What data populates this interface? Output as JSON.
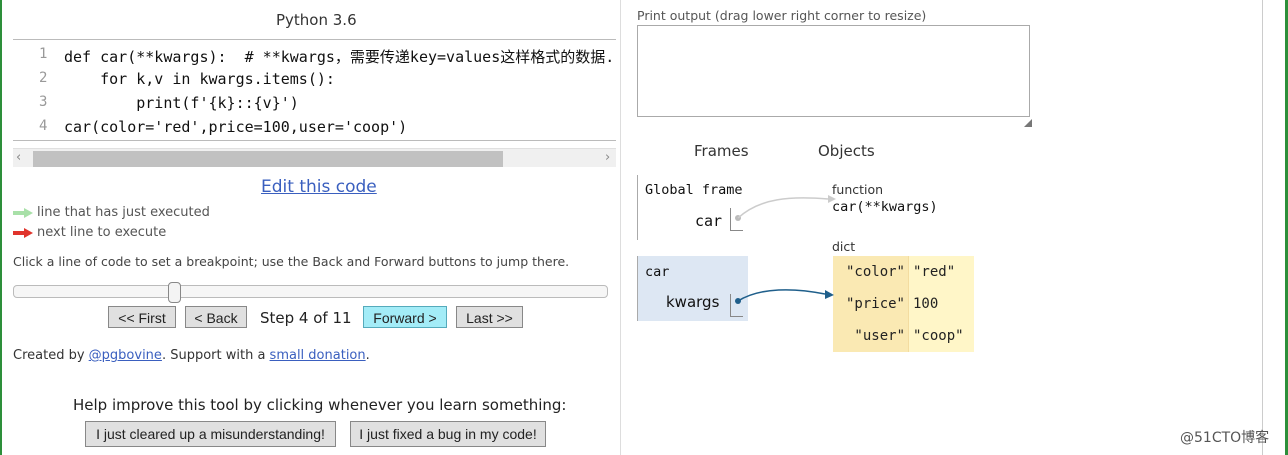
{
  "left_panel": {
    "language": "Python 3.6",
    "code_lines": [
      {
        "num": "1",
        "text": "def car(**kwargs):  # **kwargs，需要传递key=values这样格式的数据.",
        "arrow": "green"
      },
      {
        "num": "2",
        "text": "    for k,v in kwargs.items():",
        "arrow": "red"
      },
      {
        "num": "3",
        "text": "        print(f'{k}::{v}')",
        "arrow": ""
      },
      {
        "num": "4",
        "text": "car(color='red',price=100,user='coop')",
        "arrow": ""
      }
    ],
    "edit_link": "Edit this code",
    "legend": {
      "executed": "line that has just executed",
      "next": "next line to execute"
    },
    "help": "Click a line of code to set a breakpoint; use the Back and Forward buttons to jump there.",
    "nav": {
      "first": "<< First",
      "back": "< Back",
      "step": "Step 4 of 11",
      "forward": "Forward >",
      "last": "Last >>"
    },
    "slider_fraction": 0.27,
    "credits": {
      "prefix": "Created by ",
      "author": "@pgbovine",
      "middle": ". Support with a ",
      "donation": "small donation",
      "suffix": "."
    },
    "improve": {
      "text": "Help improve this tool by clicking whenever you learn something:",
      "btn1": "I just cleared up a misunderstanding!",
      "btn2": "I just fixed a bug in my code!"
    }
  },
  "right_panel": {
    "print_label": "Print output (drag lower right corner to resize)",
    "frames_header": "Frames",
    "objects_header": "Objects",
    "global_frame": {
      "title": "Global frame",
      "var": "car"
    },
    "car_frame": {
      "title": "car",
      "var": "kwargs"
    },
    "function_obj": {
      "type": "function",
      "label": "car(**kwargs)"
    },
    "dict_obj": {
      "type": "dict",
      "rows": [
        {
          "key": "\"color\"",
          "value": "\"red\""
        },
        {
          "key": "\"price\"",
          "value": "100"
        },
        {
          "key": "\"user\"",
          "value": "\"coop\""
        }
      ]
    }
  },
  "watermark": "@51CTO博客",
  "colors": {
    "green_arrow": "#a8e0a8",
    "red_arrow": "#e0342c",
    "link": "#3a5fbf",
    "forward_btn": "#a3ecf7",
    "frame_bg": "#dde7f3",
    "dict_key_bg": "#fae9b3",
    "dict_val_bg": "#fff6c8"
  }
}
